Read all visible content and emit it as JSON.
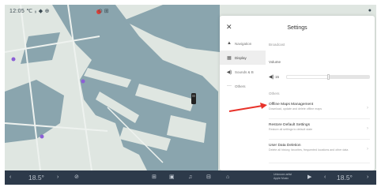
{
  "status_bar": {
    "left_text": "12:05 ℃ ᵢᵢ ◆ ⊕",
    "center_text": "⊙ ⊞"
  },
  "settings": {
    "title": "Settings",
    "nav": [
      {
        "icon": "▲",
        "label": "Navigation"
      },
      {
        "icon": "▦",
        "label": "Display"
      },
      {
        "icon": "◀)",
        "label": "Sounds & B"
      },
      {
        "icon": "···",
        "label": "Others"
      }
    ],
    "sections": {
      "general": "Broadcast",
      "volume_label": "Volume",
      "others": "Others"
    },
    "volume": {
      "value": "15",
      "level": 0.5
    },
    "items": [
      {
        "title": "Offline Maps Management",
        "subtitle": "Download, update and delete offline maps"
      },
      {
        "title": "Restore Default Settings",
        "subtitle": "Restore all settings to default state"
      },
      {
        "title": "User Data Deletion",
        "subtitle": "Delete all history, favorites, frequented locations and other data"
      }
    ]
  },
  "bottom_bar": {
    "left_temp": "18.5°",
    "right_temp": "18.5°",
    "media_title": "Unknown artist",
    "media_sub": "Apple Music"
  },
  "colors": {
    "water": "#7f9ba4",
    "land": "#dfe6e1",
    "arrow": "#e8322a",
    "bottom_bar": "#2d3a4a"
  }
}
